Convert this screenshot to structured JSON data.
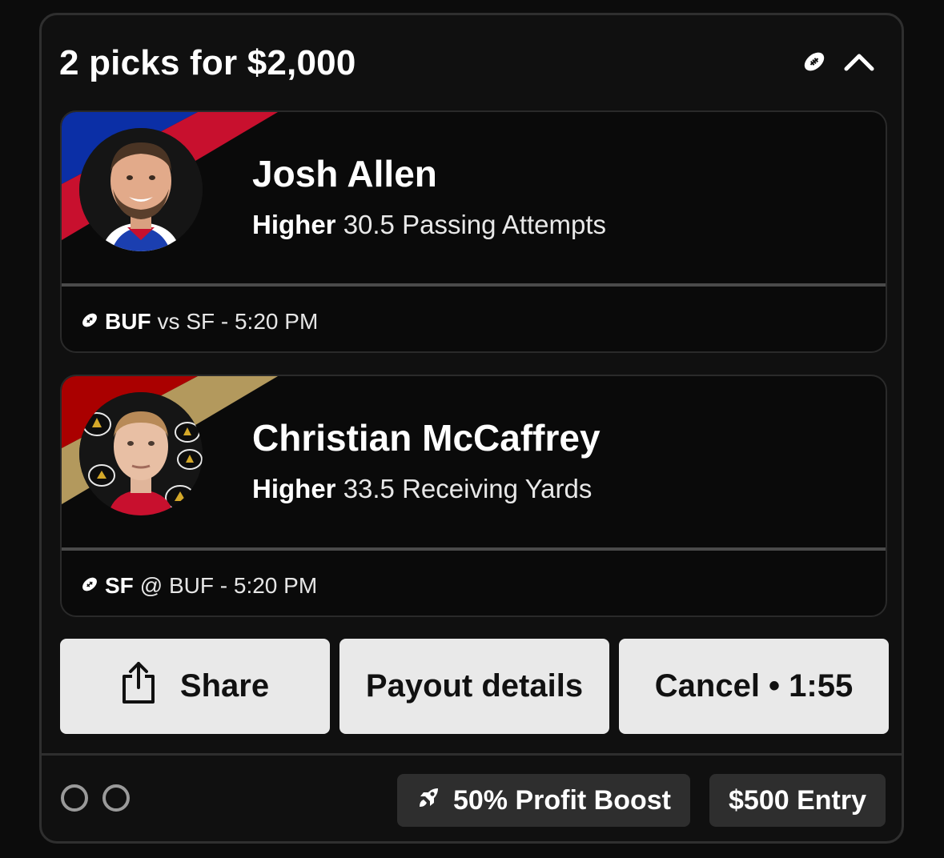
{
  "header": {
    "title": "2 picks for $2,000",
    "sport_icon": "football-icon",
    "collapse_icon": "chevron-up-icon"
  },
  "picks": [
    {
      "player": "Josh Allen",
      "direction": "Higher",
      "line": "30.5 Passing Attempts",
      "team_bold": "BUF",
      "game_rest": "vs SF - 5:20 PM",
      "team_colors": [
        "#0b2fa6",
        "#c8102e"
      ]
    },
    {
      "player": "Christian McCaffrey",
      "direction": "Higher",
      "line": "33.5 Receiving Yards",
      "team_bold": "SF",
      "game_rest": "@ BUF - 5:20 PM",
      "team_colors": [
        "#aa0000",
        "#b3995d"
      ]
    }
  ],
  "actions": {
    "share": "Share",
    "payout": "Payout details",
    "cancel": "Cancel • 1:55"
  },
  "footer": {
    "boost": "50% Profit Boost",
    "entry": "$500 Entry",
    "boost_icon": "rocket-icon"
  }
}
